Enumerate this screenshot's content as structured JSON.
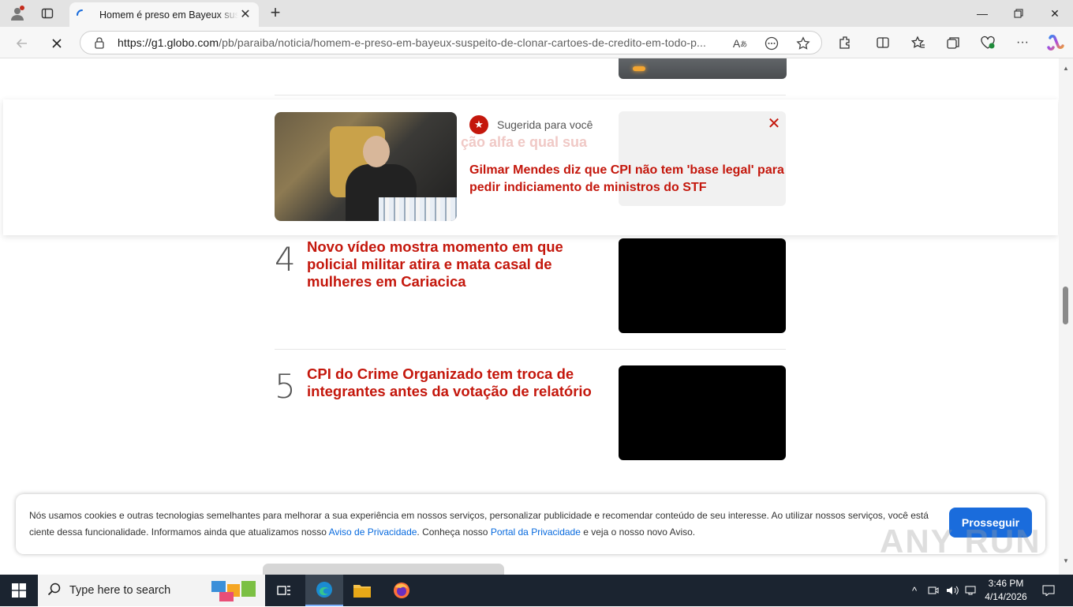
{
  "browser": {
    "tab_title": "Homem é preso em Bayeux suspeito de clonar cartões de crédito em todo o país",
    "url_host": "https://g1.globo.com",
    "url_path": "/pb/paraiba/noticia/homem-e-preso-em-bayeux-suspeito-de-clonar-cartoes-de-credito-em-todo-p..."
  },
  "ranking": [
    {
      "number": "4",
      "title": "Novo vídeo mostra momento em que policial militar atira e mata casal de mulheres em Cariacica"
    },
    {
      "number": "5",
      "title": "CPI do Crime Organizado tem troca de integrantes antes da votação de relatório"
    }
  ],
  "suggestion": {
    "label": "Sugerida para você",
    "title": "Gilmar Mendes diz que CPI não tem 'base legal' para pedir indiciamento de ministros do STF",
    "ghost_text": "ção alfa e qual sua"
  },
  "cookie": {
    "text_1": "Nós usamos cookies e outras tecnologias semelhantes para melhorar a sua experiência em nossos serviços, personalizar publicidade e recomendar conteúdo de seu interesse. Ao utilizar nossos serviços, você está ciente dessa funcionalidade. Informamos ainda que atualizamos nosso ",
    "link_privacy_notice": "Aviso de Privacidade",
    "text_2": ". Conheça nosso ",
    "link_privacy_portal": "Portal da Privacidade",
    "text_3": " e veja o nosso novo Aviso.",
    "button": "Prosseguir"
  },
  "watermark": "ANY RUN",
  "taskbar": {
    "search_placeholder": "Type here to search",
    "time": "3:46 PM",
    "date": "4/14/2026"
  },
  "colors": {
    "accent": "#c4170c",
    "button": "#1a6cdc",
    "link": "#0669de"
  }
}
